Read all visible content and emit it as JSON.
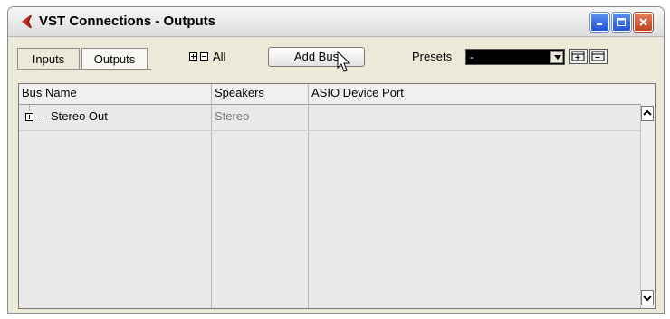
{
  "window": {
    "title": "VST Connections - Outputs",
    "accent_color": "#c8281e",
    "controls": [
      "minimize-icon",
      "maximize-icon",
      "close-icon"
    ]
  },
  "toolbar": {
    "tabs": [
      {
        "label": "Inputs",
        "selected": false
      },
      {
        "label": "Outputs",
        "selected": true
      }
    ],
    "expand_all_label": "All",
    "add_bus_label": "Add Bus",
    "presets_label": "Presets",
    "presets_value": "-"
  },
  "table": {
    "columns": [
      "Bus Name",
      "Speakers",
      "ASIO Device Port"
    ],
    "rows": [
      {
        "bus_name": "Stereo Out",
        "speakers": "Stereo",
        "asio_port": ""
      }
    ]
  }
}
